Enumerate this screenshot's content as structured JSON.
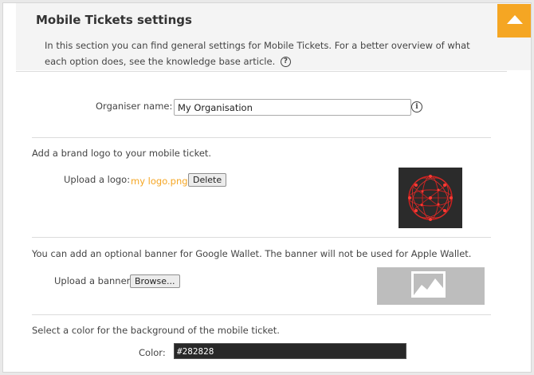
{
  "section": {
    "title": "Mobile Tickets settings",
    "description": "In this section you can find general settings for Mobile Tickets. For a better overview of what each option does, see the knowledge base article."
  },
  "organiser": {
    "label": "Organiser name:",
    "value": "My Organisation"
  },
  "logo": {
    "intro": "Add a brand logo to your mobile ticket.",
    "label": "Upload a logo:",
    "file_name": "my logo.png",
    "delete_label": "Delete"
  },
  "banner": {
    "intro": "You can add an optional banner for Google Wallet. The banner will not be used for Apple Wallet.",
    "label": "Upload a banner:",
    "browse_label": "Browse..."
  },
  "color": {
    "intro": "Select a color for the background of the mobile ticket.",
    "label": "Color:",
    "value": "#282828"
  },
  "icons": {
    "collapse": "collapse-arrow-icon",
    "help": "question-circle-icon",
    "info": "info-circle-icon",
    "image_placeholder": "image-placeholder-icon"
  },
  "colors": {
    "accent": "#f5a623",
    "ticket_background": "#282828"
  }
}
